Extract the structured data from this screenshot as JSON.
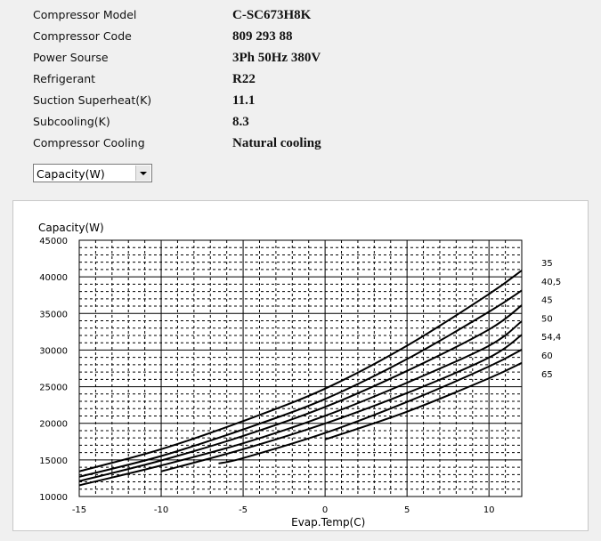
{
  "info": [
    {
      "label": "Compressor  Model",
      "value": "C-SC673H8K"
    },
    {
      "label": "Compressor Code",
      "value": "809 293 88"
    },
    {
      "label": "Power Sourse",
      "value": "3Ph  50Hz  380V"
    },
    {
      "label": "Refrigerant",
      "value": "R22"
    },
    {
      "label": "Suction Superheat(K)",
      "value": "11.1"
    },
    {
      "label": "Subcooling(K)",
      "value": "8.3"
    },
    {
      "label": "Compressor Cooling",
      "value": "Natural cooling"
    }
  ],
  "selector": {
    "selected": "Capacity(W)"
  },
  "chart_data": {
    "type": "line",
    "title": "",
    "xlabel": "Evap.Temp(C)",
    "ylabel": "Capacity(W)",
    "xlim": [
      -15,
      12
    ],
    "ylim": [
      10000,
      45000
    ],
    "xticks": [
      -15,
      -10,
      -5,
      0,
      5,
      10
    ],
    "yticks": [
      10000,
      15000,
      20000,
      25000,
      30000,
      35000,
      40000,
      45000
    ],
    "grid": true,
    "legend_placement": "right",
    "series": [
      {
        "name": "35",
        "points": [
          [
            -15,
            13430
          ],
          [
            -10,
            16460
          ],
          [
            -5,
            20300
          ],
          [
            0,
            24730
          ],
          [
            5,
            30600
          ],
          [
            10,
            37650
          ],
          [
            12,
            40880
          ]
        ]
      },
      {
        "name": "40,5",
        "points": [
          [
            -15,
            12700
          ],
          [
            -10,
            15530
          ],
          [
            -5,
            19160
          ],
          [
            0,
            23320
          ],
          [
            5,
            28770
          ],
          [
            10,
            35230
          ],
          [
            12,
            38140
          ]
        ]
      },
      {
        "name": "45",
        "points": [
          [
            -15,
            12100
          ],
          [
            -10,
            14920
          ],
          [
            -5,
            18270
          ],
          [
            0,
            22230
          ],
          [
            5,
            27160
          ],
          [
            10,
            32810
          ],
          [
            12,
            36120
          ]
        ]
      },
      {
        "name": "50",
        "points": [
          [
            -15,
            11530
          ],
          [
            -10,
            14240
          ],
          [
            -5,
            17270
          ],
          [
            0,
            21020
          ],
          [
            5,
            25540
          ],
          [
            10,
            30590
          ],
          [
            12,
            33940
          ]
        ]
      },
      {
        "name": "54,4",
        "points": [
          [
            -10,
            13430
          ],
          [
            -5,
            16460
          ],
          [
            0,
            19970
          ],
          [
            5,
            24130
          ],
          [
            10,
            28970
          ],
          [
            12,
            32080
          ]
        ]
      },
      {
        "name": "60",
        "points": [
          [
            -6.5,
            14520
          ],
          [
            -5,
            15250
          ],
          [
            0,
            18680
          ],
          [
            5,
            22920
          ],
          [
            10,
            27760
          ],
          [
            12,
            30060
          ]
        ]
      },
      {
        "name": "65",
        "points": [
          [
            0,
            17790
          ],
          [
            5,
            21590
          ],
          [
            10,
            26150
          ],
          [
            12,
            28250
          ]
        ]
      }
    ]
  }
}
